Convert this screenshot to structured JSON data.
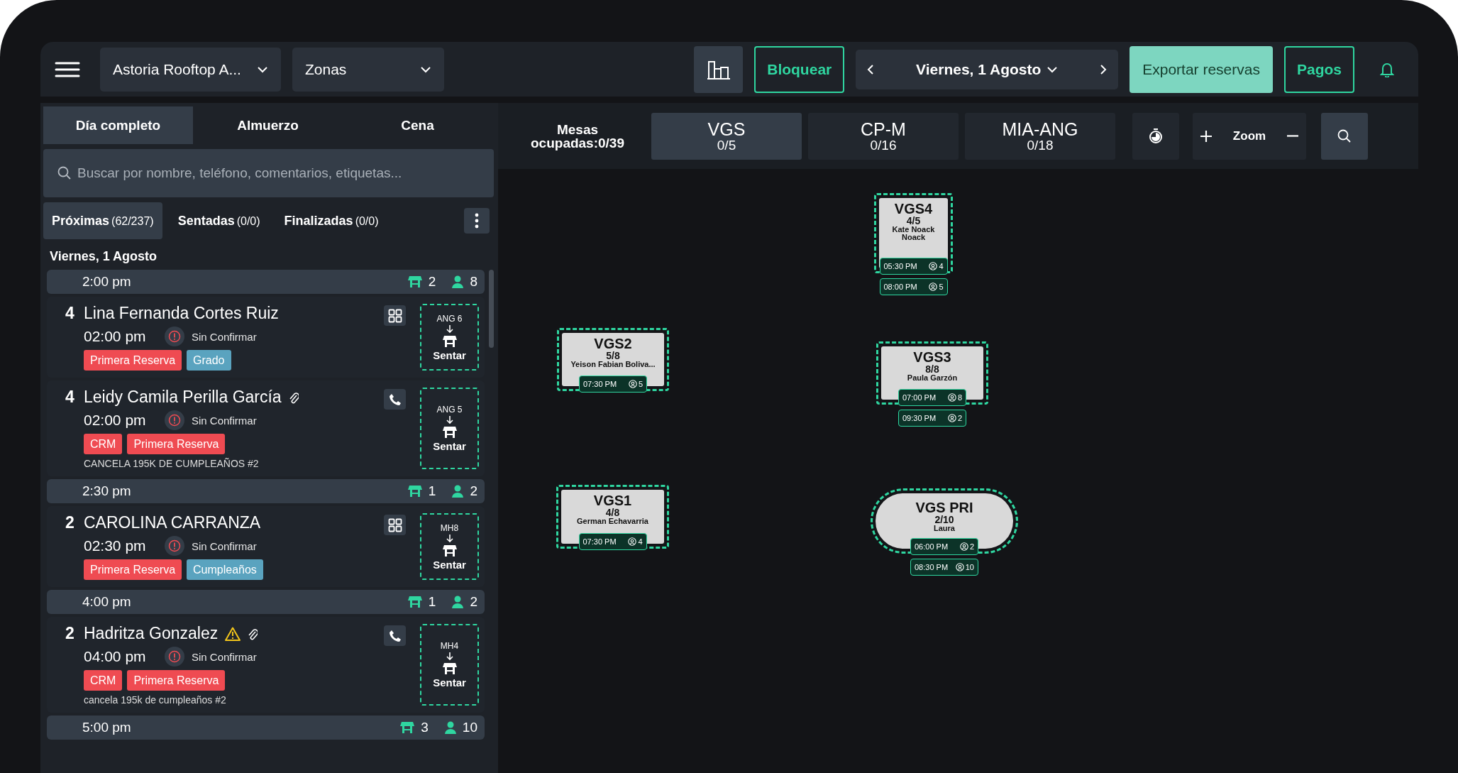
{
  "topbar": {
    "venue": "Astoria Rooftop A...",
    "zones": "Zonas",
    "block_button": "Bloquear",
    "date": "Viernes, 1 Agosto",
    "export_button": "Exportar reservas",
    "payments_button": "Pagos"
  },
  "service_tabs": [
    {
      "label": "Día completo",
      "selected": true
    },
    {
      "label": "Almuerzo",
      "selected": false
    },
    {
      "label": "Cena",
      "selected": false
    }
  ],
  "search": {
    "placeholder": "Buscar por nombre, teléfono, comentarios, etiquetas..."
  },
  "filter_tabs": [
    {
      "label": "Próximas",
      "count": "(62/237)",
      "selected": true
    },
    {
      "label": "Sentadas",
      "count": "(0/0)",
      "selected": false
    },
    {
      "label": "Finalizadas",
      "count": "(0/0)",
      "selected": false
    }
  ],
  "list_date": "Viernes, 1 Agosto",
  "groups": [
    {
      "time": "2:00 pm",
      "tables": "2",
      "guests": "8",
      "reservations": [
        {
          "party": "4",
          "name": "Lina Fernanda Cortes Ruiz",
          "warning": false,
          "attachment": false,
          "time": "02:00 pm",
          "status": "Sin Confirmar",
          "tags": [
            {
              "text": "Primera Reserva",
              "color": "#ef4b52"
            },
            {
              "text": "Grado",
              "color": "#5aa3bf"
            }
          ],
          "kind": "grid",
          "table": "ANG 6",
          "seat": "Sentar"
        },
        {
          "party": "4",
          "name": "Leidy Camila Perilla García",
          "warning": false,
          "attachment": true,
          "time": "02:00 pm",
          "status": "Sin Confirmar",
          "tags": [
            {
              "text": "CRM",
              "color": "#ef4b52"
            },
            {
              "text": "Primera Reserva",
              "color": "#ef4b52"
            }
          ],
          "note": "CANCELA 195K DE CUMPLEAÑOS #2",
          "kind": "phone",
          "table": "ANG 5",
          "seat": "Sentar"
        }
      ]
    },
    {
      "time": "2:30 pm",
      "tables": "1",
      "guests": "2",
      "reservations": [
        {
          "party": "2",
          "name": "CAROLINA CARRANZA",
          "warning": false,
          "attachment": false,
          "time": "02:30 pm",
          "status": "Sin Confirmar",
          "tags": [
            {
              "text": "Primera Reserva",
              "color": "#ef4b52"
            },
            {
              "text": "Cumpleaños",
              "color": "#5aa3bf"
            }
          ],
          "kind": "grid",
          "table": "MH8",
          "seat": "Sentar"
        }
      ]
    },
    {
      "time": "4:00 pm",
      "tables": "1",
      "guests": "2",
      "reservations": [
        {
          "party": "2",
          "name": "Hadritza Gonzalez",
          "warning": true,
          "attachment": true,
          "time": "04:00 pm",
          "status": "Sin Confirmar",
          "tags": [
            {
              "text": "CRM",
              "color": "#ef4b52"
            },
            {
              "text": "Primera Reserva",
              "color": "#ef4b52"
            }
          ],
          "note": "cancela 195k de cumpleaños #2",
          "kind": "phone",
          "table": "MH4",
          "seat": "Sentar"
        }
      ]
    },
    {
      "time": "5:00 pm",
      "tables": "3",
      "guests": "10"
    }
  ],
  "occupancy": "Mesas ocupadas:0/39",
  "zones": [
    {
      "name": "VGS",
      "count": "0/5",
      "selected": true
    },
    {
      "name": "CP-M",
      "count": "0/16",
      "selected": false
    },
    {
      "name": "MIA-ANG",
      "count": "0/18",
      "selected": false
    }
  ],
  "zoom_label": "Zoom",
  "tables": [
    {
      "name": "VGS4",
      "kind": "rect",
      "occupancy": "4/5",
      "guest": "Kate Noack Noack",
      "bookings": [
        {
          "time": "05:30 PM",
          "guests": "4"
        },
        {
          "time": "08:00 PM",
          "guests": "5"
        }
      ]
    },
    {
      "name": "VGS2",
      "kind": "rect",
      "occupancy": "5/8",
      "guest": "Yeison Fabian Boliva...",
      "bookings": [
        {
          "time": "07:30 PM",
          "guests": "5"
        }
      ]
    },
    {
      "name": "VGS3",
      "kind": "rect",
      "occupancy": "8/8",
      "guest": "Paula Garzón",
      "bookings": [
        {
          "time": "07:00 PM",
          "guests": "8"
        },
        {
          "time": "09:30 PM",
          "guests": "2"
        }
      ]
    },
    {
      "name": "VGS1",
      "kind": "rect",
      "occupancy": "4/8",
      "guest": "German Echavarria",
      "bookings": [
        {
          "time": "07:30 PM",
          "guests": "4"
        }
      ]
    },
    {
      "name": "VGS PRI",
      "kind": "pill",
      "occupancy": "2/10",
      "guest": "Laura",
      "bookings": [
        {
          "time": "06:00 PM",
          "guests": "2"
        },
        {
          "time": "08:30 PM",
          "guests": "10"
        }
      ]
    }
  ]
}
